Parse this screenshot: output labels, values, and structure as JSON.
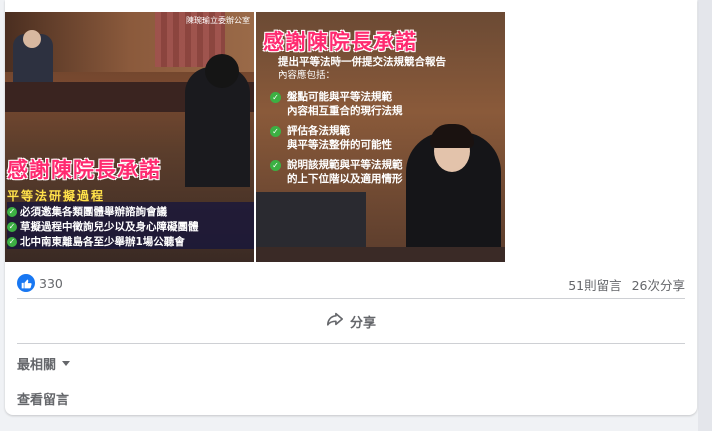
{
  "post": {
    "left_photo": {
      "corner_caption": "陳琬瑜立委辦公室",
      "title": "感謝陳院長承諾",
      "subtitle": "平等法研擬過程",
      "items": [
        "必須邀集各類團體舉辦諮詢會議",
        "草擬過程中徵詢兒少以及身心障礙團體",
        "北中南東離島各至少舉辦1場公聽會"
      ]
    },
    "right_photo": {
      "title": "感謝陳院長承諾",
      "subtitle": "提出平等法時一併提交法規競合報告",
      "label": "內容應包括：",
      "items": [
        [
          "盤點可能與平等法規範",
          "內容相互重合的現行法規"
        ],
        [
          "評估各法規範",
          "與平等法整併的可能性"
        ],
        [
          "說明該規範與平等法規範",
          "的上下位階以及適用情形"
        ]
      ]
    }
  },
  "engagement": {
    "reaction_count": "330",
    "comments": "51則留言",
    "shares": "26次分享",
    "share_label": "分享"
  },
  "comments_section": {
    "sort_label": "最相關",
    "view_comments": "查看留言"
  },
  "icons": {
    "like": "like-icon",
    "share": "share-icon",
    "check": "check-icon",
    "caret": "chevron-down-icon"
  },
  "colors": {
    "accent": "#1877f2",
    "title_pink": "#ff2a70",
    "subtitle_yellow": "#ffe14a",
    "muted_text": "#65676b"
  }
}
